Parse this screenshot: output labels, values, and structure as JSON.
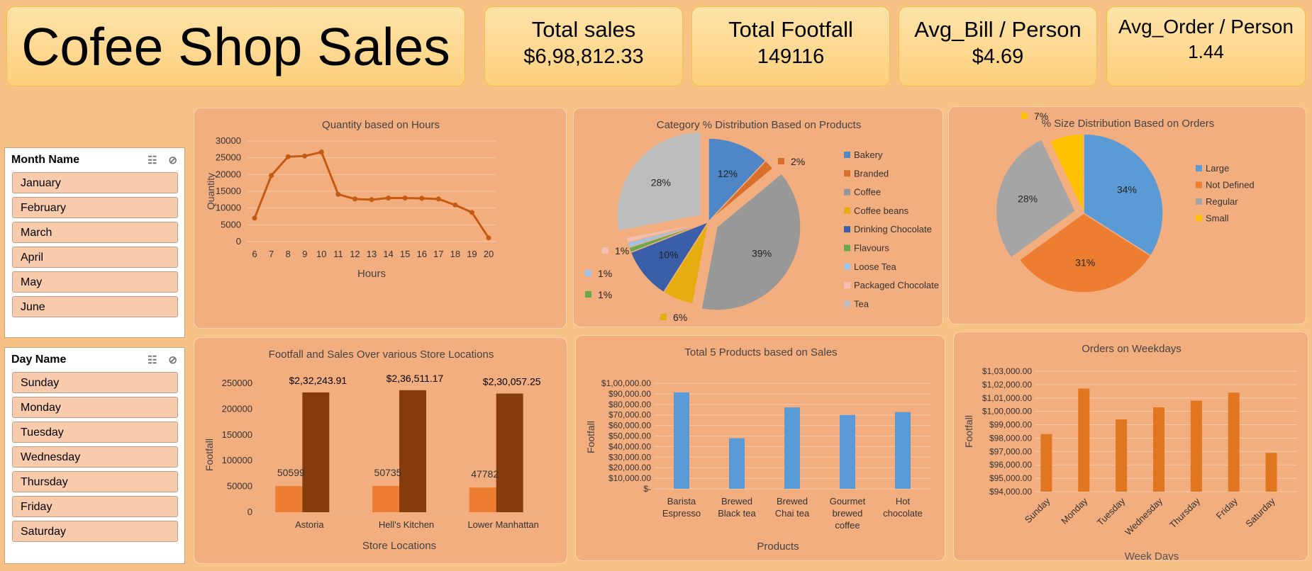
{
  "header": {
    "title": "Cofee Shop Sales"
  },
  "kpis": [
    {
      "label": "Total sales",
      "value": "$6,98,812.33"
    },
    {
      "label": "Total Footfall",
      "value": "149116"
    },
    {
      "label": "Avg_Bill / Person",
      "value": "$4.69"
    },
    {
      "label": "Avg_Order / Person",
      "value": "1.44"
    }
  ],
  "slicers": {
    "month": {
      "title": "Month Name",
      "items": [
        "January",
        "February",
        "March",
        "April",
        "May",
        "June"
      ]
    },
    "day": {
      "title": "Day Name",
      "items": [
        "Sunday",
        "Monday",
        "Tuesday",
        "Wednesday",
        "Thursday",
        "Friday",
        "Saturday"
      ]
    }
  },
  "colors": {
    "background": "#f7c285",
    "panel": "#f3ae80",
    "line": "#c55a11",
    "blue": "#5b9bd5",
    "orange": "#ed7d31",
    "dark_brown": "#843c0c",
    "bar_orange": "#e0761f"
  },
  "chart_data": [
    {
      "type": "line",
      "title": "Quantity based on Hours",
      "xlabel": "Hours",
      "ylabel": "Quantity",
      "x": [
        6,
        7,
        8,
        9,
        10,
        11,
        12,
        13,
        14,
        15,
        16,
        17,
        18,
        19,
        20
      ],
      "values": [
        7000,
        19700,
        25300,
        25500,
        26700,
        14100,
        12700,
        12500,
        13000,
        13000,
        12900,
        12700,
        10900,
        8700,
        1100
      ],
      "yticks": [
        "0",
        "5000",
        "10000",
        "15000",
        "20000",
        "25000",
        "30000"
      ],
      "ylim": [
        0,
        30000
      ],
      "grid": true
    },
    {
      "type": "pie",
      "title": "Category % Distribution Based on Products",
      "labels": [
        "Bakery",
        "Branded",
        "Coffee",
        "Coffee beans",
        "Drinking Chocolate",
        "Flavours",
        "Loose Tea",
        "Packaged Chocolate",
        "Tea"
      ],
      "values": [
        12,
        2,
        39,
        6,
        10,
        1,
        1,
        1,
        28
      ],
      "display_labels": [
        "12%",
        "2%",
        "39%",
        "6%",
        "10%",
        "1%",
        "1%",
        "1%",
        "28%"
      ],
      "colors": [
        "#4f86c6",
        "#d86f2b",
        "#989898",
        "#e6ad10",
        "#3a5ea8",
        "#6aa84f",
        "#9dc3e6",
        "#f2bfb0",
        "#bdbdbd"
      ],
      "legend": "right"
    },
    {
      "type": "pie",
      "title": "% Size Distribution Based on Orders",
      "labels": [
        "Large",
        "Not Defined",
        "Regular",
        "Small"
      ],
      "values": [
        34,
        31,
        28,
        7
      ],
      "display_labels": [
        "34%",
        "31%",
        "28%",
        "7%"
      ],
      "colors": [
        "#5b9bd5",
        "#ed7d31",
        "#a5a5a5",
        "#ffc000"
      ],
      "legend": "right"
    },
    {
      "type": "bar",
      "title": "Footfall and Sales Over various Store Locations",
      "xlabel": "Store Locations",
      "ylabel": "Footfall",
      "categories": [
        "Astoria",
        "Hell's Kitchen",
        "Lower Manhattan"
      ],
      "series": [
        {
          "values": [
            50599,
            50735,
            47782
          ],
          "display": [
            "50599",
            "50735",
            "47782"
          ]
        },
        {
          "values": [
            232243.91,
            236511.17,
            230057.25
          ],
          "display": [
            "$2,32,243.91",
            "$2,36,511.17",
            "$2,30,057.25"
          ]
        }
      ],
      "yticks": [
        "0",
        "50000",
        "100000",
        "150000",
        "200000",
        "250000"
      ],
      "ylim": [
        0,
        250000
      ]
    },
    {
      "type": "bar",
      "title": "Total 5 Products based on Sales",
      "xlabel": "Products",
      "ylabel": "Footfall",
      "categories": [
        [
          "Barista",
          "Espresso"
        ],
        [
          "Brewed",
          "Black tea"
        ],
        [
          "Brewed",
          "Chai tea"
        ],
        [
          "Gourmet",
          "brewed",
          "coffee"
        ],
        [
          "Hot",
          "chocolate"
        ]
      ],
      "values": [
        91400,
        47900,
        77100,
        70000,
        72700
      ],
      "yticks": [
        "$-",
        "$10,000.00",
        "$20,000.00",
        "$30,000.00",
        "$40,000.00",
        "$50,000.00",
        "$60,000.00",
        "$70,000.00",
        "$80,000.00",
        "$90,000.00",
        "$1,00,000.00"
      ],
      "ylim": [
        0,
        100000
      ]
    },
    {
      "type": "bar",
      "title": "Orders on Weekdays",
      "xlabel": "Week Days",
      "ylabel": "Footfall",
      "categories": [
        "Sunday",
        "Monday",
        "Tuesday",
        "Wednesday",
        "Thursday",
        "Friday",
        "Saturday"
      ],
      "values": [
        98300,
        101700,
        99400,
        100300,
        100800,
        101400,
        96900
      ],
      "yticks": [
        "$94,000.00",
        "$95,000.00",
        "$96,000.00",
        "$97,000.00",
        "$98,000.00",
        "$99,000.00",
        "$1,00,000.00",
        "$1,01,000.00",
        "$1,02,000.00",
        "$1,03,000.00"
      ],
      "ylim": [
        94000,
        103000
      ]
    }
  ]
}
